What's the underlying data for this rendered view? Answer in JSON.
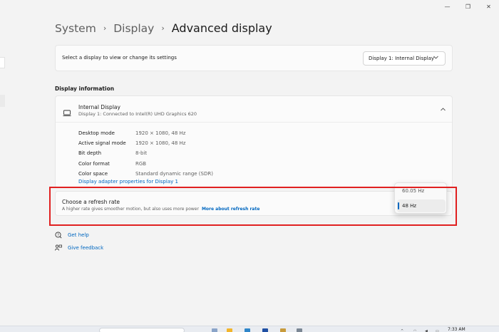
{
  "window": {
    "minimize_glyph": "—",
    "restore_glyph": "❐",
    "close_glyph": "✕"
  },
  "breadcrumb": {
    "items": [
      "System",
      "Display",
      "Advanced display"
    ],
    "separator": "›"
  },
  "display_select": {
    "label": "Select a display to view or change its settings",
    "selected": "Display 1: Internal Display"
  },
  "display_information": {
    "section_title": "Display information",
    "display_name": "Internal Display",
    "display_connection": "Display 1: Connected to Intel(R) UHD Graphics 620",
    "properties": [
      {
        "key": "Desktop mode",
        "value": "1920 × 1080, 48 Hz"
      },
      {
        "key": "Active signal mode",
        "value": "1920 × 1080, 48 Hz"
      },
      {
        "key": "Bit depth",
        "value": "8-bit"
      },
      {
        "key": "Color format",
        "value": "RGB"
      },
      {
        "key": "Color space",
        "value": "Standard dynamic range (SDR)"
      }
    ],
    "adapter_link": "Display adapter properties for Display 1"
  },
  "refresh_rate": {
    "title": "Choose a refresh rate",
    "description": "A higher rate gives smoother motion, but also uses more power",
    "link": "More about refresh rate",
    "options": [
      "60.05 Hz",
      "48 Hz"
    ],
    "selected": "48 Hz"
  },
  "help_links": {
    "get_help": "Get help",
    "give_feedback": "Give feedback"
  },
  "taskbar": {
    "time": "7:33 AM"
  },
  "colors": {
    "accent": "#0067c0",
    "highlight_box": "#e02020",
    "background": "#f3f3f3",
    "card": "#fbfbfb"
  },
  "icons": [
    "laptop-icon",
    "chevron-down-icon",
    "chevron-up-icon",
    "help-icon",
    "feedback-icon",
    "windows-start-icon"
  ]
}
